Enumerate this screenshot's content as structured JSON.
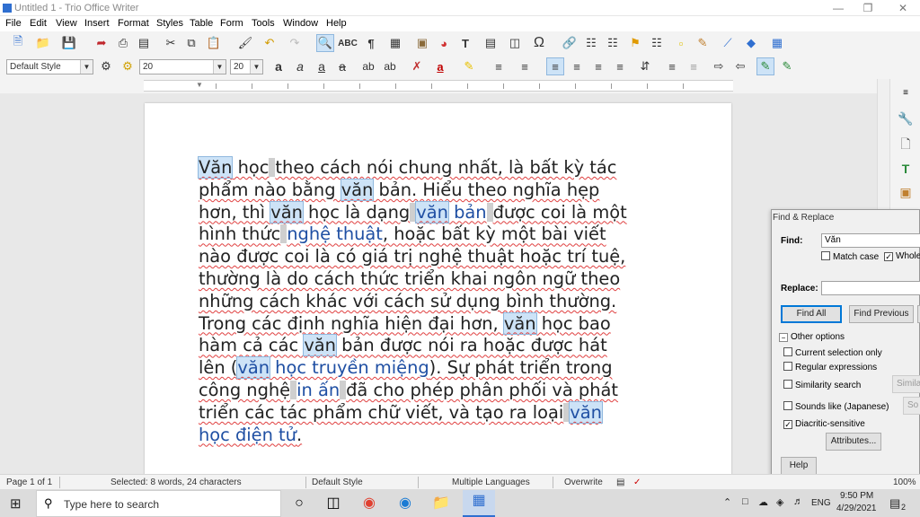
{
  "window": {
    "title": "Untitled 1 - Trio Office Writer"
  },
  "menu": [
    "File",
    "Edit",
    "View",
    "Insert",
    "Format",
    "Styles",
    "Table",
    "Form",
    "Tools",
    "Window",
    "Help"
  ],
  "formatting": {
    "para_style": "Default Style",
    "font_name": "20",
    "font_size": "20"
  },
  "document": {
    "lines": [
      [
        {
          "t": "Văn",
          "hl": true
        },
        {
          "t": " học"
        },
        {
          "c": true
        },
        {
          "t": "theo cách nói chung nhất, là bất kỳ tác"
        }
      ],
      [
        {
          "t": "phẩm nào bằng "
        },
        {
          "t": "văn",
          "hl": true
        },
        {
          "t": " bản. Hiểu theo nghĩa hẹp"
        }
      ],
      [
        {
          "t": "hơn, thì "
        },
        {
          "t": "văn",
          "hl": true
        },
        {
          "t": " học là dạng"
        },
        {
          "c": true
        },
        {
          "t": "văn",
          "hl": true,
          "lk": true
        },
        {
          "t": " bản",
          "lk": true
        },
        {
          "c": true
        },
        {
          "t": "được coi là một"
        }
      ],
      [
        {
          "t": "hình thức"
        },
        {
          "c": true
        },
        {
          "t": "nghệ thuật",
          "lk": true
        },
        {
          "t": ", hoặc bất kỳ một bài viết"
        }
      ],
      [
        {
          "t": "nào được coi là có giá trị nghệ thuật hoặc trí tuệ,"
        }
      ],
      [
        {
          "t": "thường là do cách thức triển khai ngôn ngữ theo"
        }
      ],
      [
        {
          "t": "những cách khác với cách sử dụng bình thường."
        }
      ],
      [
        {
          "t": "Trong các định nghĩa hiện đại hơn, "
        },
        {
          "t": "văn",
          "hl": true
        },
        {
          "t": " học bao"
        }
      ],
      [
        {
          "t": "hàm cả các "
        },
        {
          "t": "văn",
          "hl": true
        },
        {
          "t": " bản được nói ra hoặc được hát"
        }
      ],
      [
        {
          "t": "lên ("
        },
        {
          "t": "văn",
          "hl": true,
          "lk": true
        },
        {
          "t": " học truyền miệng",
          "lk": true
        },
        {
          "t": "). Sự phát triển trong"
        }
      ],
      [
        {
          "t": "công nghệ"
        },
        {
          "c": true
        },
        {
          "t": "in ấn",
          "lk": true
        },
        {
          "c": true
        },
        {
          "t": "đã cho phép phân phối và phát"
        }
      ],
      [
        {
          "t": "triển các tác phẩm chữ viết, và tạo ra loại"
        },
        {
          "c": true
        },
        {
          "t": "văn",
          "hl": true,
          "lk": true
        }
      ],
      [
        {
          "t": "học điện tử",
          "lk": true
        },
        {
          "t": "."
        }
      ]
    ]
  },
  "status": {
    "page": "Page 1 of 1",
    "selection": "Selected: 8 words, 24 characters",
    "style": "Default Style",
    "language": "Multiple Languages",
    "mode": "Overwrite",
    "zoom": "100%"
  },
  "find_replace": {
    "title": "Find & Replace",
    "find_label": "Find:",
    "find_value": "Văn",
    "match_case": "Match case",
    "whole_words": "Whole",
    "replace_label": "Replace:",
    "replace_value": "",
    "find_all": "Find All",
    "find_previous": "Find Previous",
    "other_options": "Other options",
    "current_selection": "Current selection only",
    "regex": "Regular expressions",
    "similarity": "Similarity search",
    "similarity_btn": "Simila",
    "sounds_like": "Sounds like (Japanese)",
    "sounds_btn": "So",
    "diacritic": "Diacritic-sensitive",
    "attributes": "Attributes...",
    "help": "Help"
  },
  "taskbar": {
    "search_placeholder": "Type here to search",
    "lang": "ENG",
    "time": "9:50 PM",
    "date": "4/29/2021",
    "notifications": "2"
  }
}
